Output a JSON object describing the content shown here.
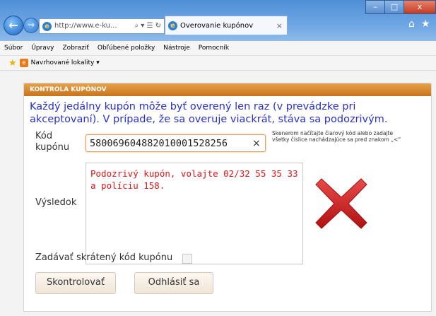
{
  "browser": {
    "url_display": "http://www.e-ku...",
    "address_tools": "⌕ ▾ ☰ ↻",
    "tab_title": "Overovanie kupónov",
    "tab_close": "×",
    "window_controls": {
      "minimize": "–",
      "maximize": "□",
      "close": "x"
    },
    "menu": [
      "Súbor",
      "Úpravy",
      "Zobraziť",
      "Obľúbené položky",
      "Nástroje",
      "Pomocník"
    ],
    "favorites_item": "Navrhované lokality ▾"
  },
  "panel": {
    "header": "KONTROLA KUPÓNOV",
    "notice": "Každý jedálny kupón môže byť overený len raz (v prevádzke pri akceptovaní). V prípade, že sa overuje viackrát, stáva sa podozrivým.",
    "code_label_line1": "Kód",
    "code_label_line2": "kupónu",
    "code_value": "5800696048820100015282​56",
    "clear_symbol": "×",
    "hint": "Skenerom načítajte čiarový kód alebo zadajte všetky číslice nachádzajúce sa pred znakom „<“",
    "result_label": "Výsledok",
    "result_text": "Podozrivý kupón, volajte 02/32 55 35 33 a políciu 158.",
    "short_code_label": "Zadávať skrátený kód kupónu",
    "check_button": "Skontrolovať",
    "logout_button": "Odhlásiť sa"
  },
  "colors": {
    "header_orange": "#d98a2e",
    "notice_blue": "#2a31c9",
    "error_red": "#e01515",
    "x_red": "#c41a1a"
  },
  "icons": [
    "back-arrow-icon",
    "forward-arrow-icon",
    "ie-logo-icon",
    "home-icon",
    "star-icon",
    "red-x-icon"
  ]
}
